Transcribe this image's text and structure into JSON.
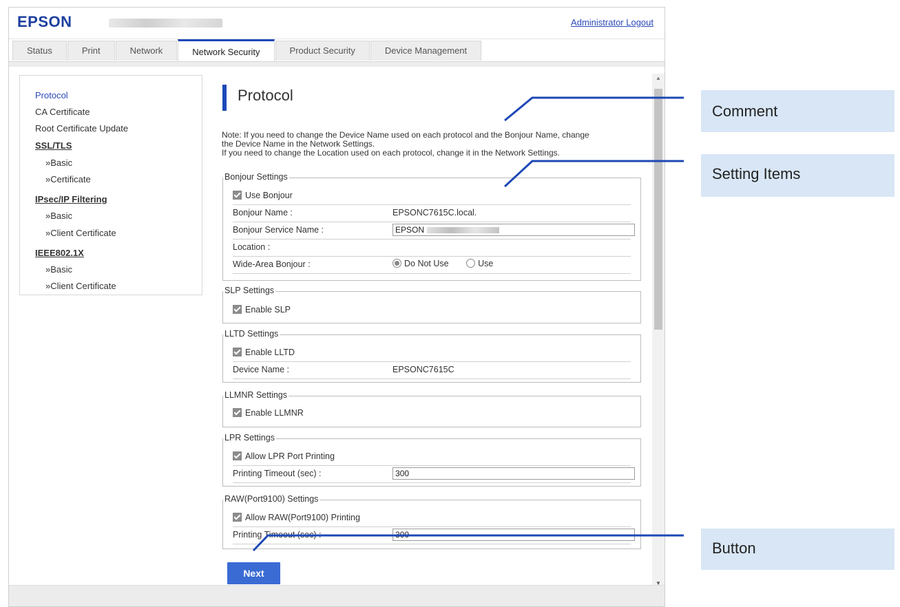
{
  "header": {
    "logo": "EPSON",
    "admin_logout": "Administrator Logout"
  },
  "tabs": [
    {
      "label": "Status"
    },
    {
      "label": "Print"
    },
    {
      "label": "Network"
    },
    {
      "label": "Network Security",
      "active": true
    },
    {
      "label": "Product Security"
    },
    {
      "label": "Device Management"
    }
  ],
  "sidebar": {
    "protocol": "Protocol",
    "ca_certificate": "CA Certificate",
    "root_cert_update": "Root Certificate Update",
    "ssl_tls": "SSL/TLS",
    "ssl_basic": "»Basic",
    "ssl_certificate": "»Certificate",
    "ipsec": "IPsec/IP Filtering",
    "ipsec_basic": "»Basic",
    "ipsec_client_cert": "»Client Certificate",
    "ieee": "IEEE802.1X",
    "ieee_basic": "»Basic",
    "ieee_client_cert": "»Client Certificate"
  },
  "main": {
    "title": "Protocol",
    "note_line1": "Note: If you need to change the Device Name used on each protocol and the Bonjour Name, change",
    "note_line2": "the Device Name in the Network Settings.",
    "note_line3": "If you need to change the Location used on each protocol, change it in the Network Settings."
  },
  "bonjour": {
    "legend": "Bonjour Settings",
    "use_bonjour": "Use Bonjour",
    "name_label": "Bonjour Name :",
    "name_value": "EPSONC7615C.local.",
    "service_label": "Bonjour Service Name :",
    "service_value": "EPSON",
    "location_label": "Location :",
    "wide_area_label": "Wide-Area Bonjour :",
    "do_not_use": "Do Not Use",
    "use": "Use"
  },
  "slp": {
    "legend": "SLP Settings",
    "enable": "Enable SLP"
  },
  "lltd": {
    "legend": "LLTD Settings",
    "enable": "Enable LLTD",
    "device_name_label": "Device Name :",
    "device_name_value": "EPSONC7615C"
  },
  "llmnr": {
    "legend": "LLMNR Settings",
    "enable": "Enable LLMNR"
  },
  "lpr": {
    "legend": "LPR Settings",
    "allow": "Allow LPR Port Printing",
    "timeout_label": "Printing Timeout (sec) :",
    "timeout_value": "300"
  },
  "raw": {
    "legend": "RAW(Port9100) Settings",
    "allow": "Allow RAW(Port9100) Printing",
    "timeout_label": "Printing Timeout (sec) :",
    "timeout_value": "300"
  },
  "next_button": "Next",
  "callouts": {
    "comment": "Comment",
    "setting_items": "Setting Items",
    "button": "Button"
  },
  "colors": {
    "brand": "#1d3f9e",
    "accent": "#1d48b6",
    "button": "#3a6bd4",
    "callout_bg": "#d8e6f5",
    "callout_line": "#1d48b6"
  }
}
